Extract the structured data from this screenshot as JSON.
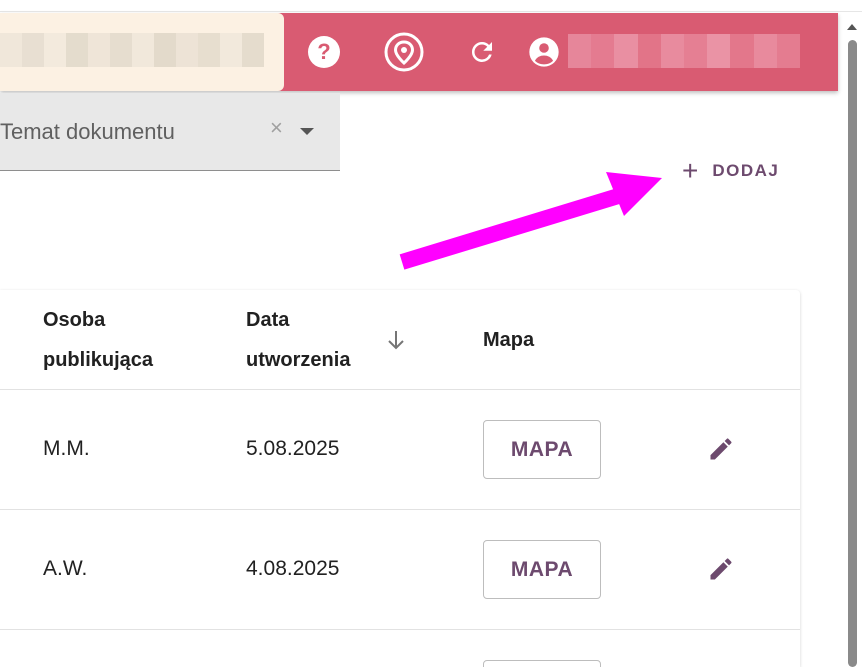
{
  "header": {
    "background": "#d95b72",
    "search_background": "#fcf1e3",
    "icons": [
      "help-icon",
      "location-pin-icon",
      "refresh-icon",
      "account-icon"
    ]
  },
  "filter": {
    "label": "Temat dokumentu",
    "clear_symbol": "×"
  },
  "toolbar": {
    "add_symbol": "+",
    "add_label": "DODAJ"
  },
  "table": {
    "columns": [
      "Osoba publikująca",
      "Data utworzenia",
      "Mapa"
    ],
    "column_lines": [
      [
        "Osoba",
        "publikująca"
      ],
      [
        "Data",
        "utworzenia"
      ],
      [
        "Mapa"
      ]
    ],
    "rows": [
      {
        "person": "M.M.",
        "date": "5.08.2025",
        "map_button": "MAPA"
      },
      {
        "person": "A.W.",
        "date": "4.08.2025",
        "map_button": "MAPA"
      }
    ]
  },
  "colors": {
    "accent": "#6d4a6e",
    "annotation_arrow": "#ff00ff"
  }
}
